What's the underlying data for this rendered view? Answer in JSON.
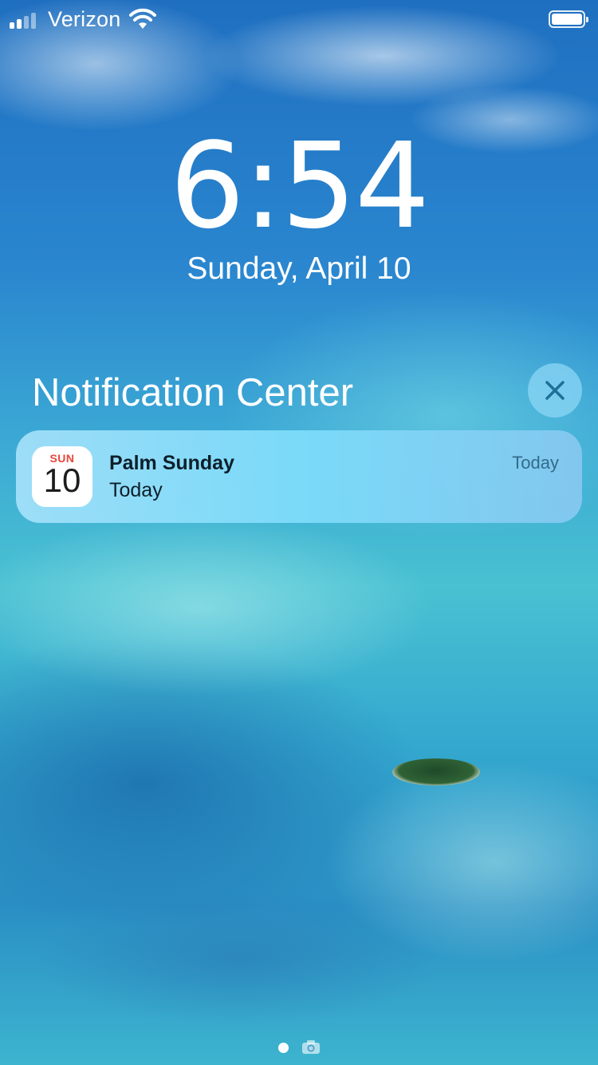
{
  "status_bar": {
    "carrier": "Verizon",
    "signal_bars_filled": 2,
    "signal_bars_total": 4,
    "battery_level": 1.0
  },
  "lock_screen": {
    "time": "6:54",
    "date": "Sunday, April 10"
  },
  "notification_center": {
    "title": "Notification Center",
    "close_icon": "close-icon",
    "notifications": [
      {
        "app_icon": "calendar-icon",
        "icon_day": "SUN",
        "icon_date": "10",
        "title": "Palm Sunday",
        "body": "Today",
        "time": "Today"
      }
    ]
  },
  "page_indicator": {
    "current_page": 1,
    "camera_icon": "camera-icon"
  },
  "colors": {
    "calendar_day_red": "#e8463b",
    "notification_text": "#0d1f2b"
  }
}
